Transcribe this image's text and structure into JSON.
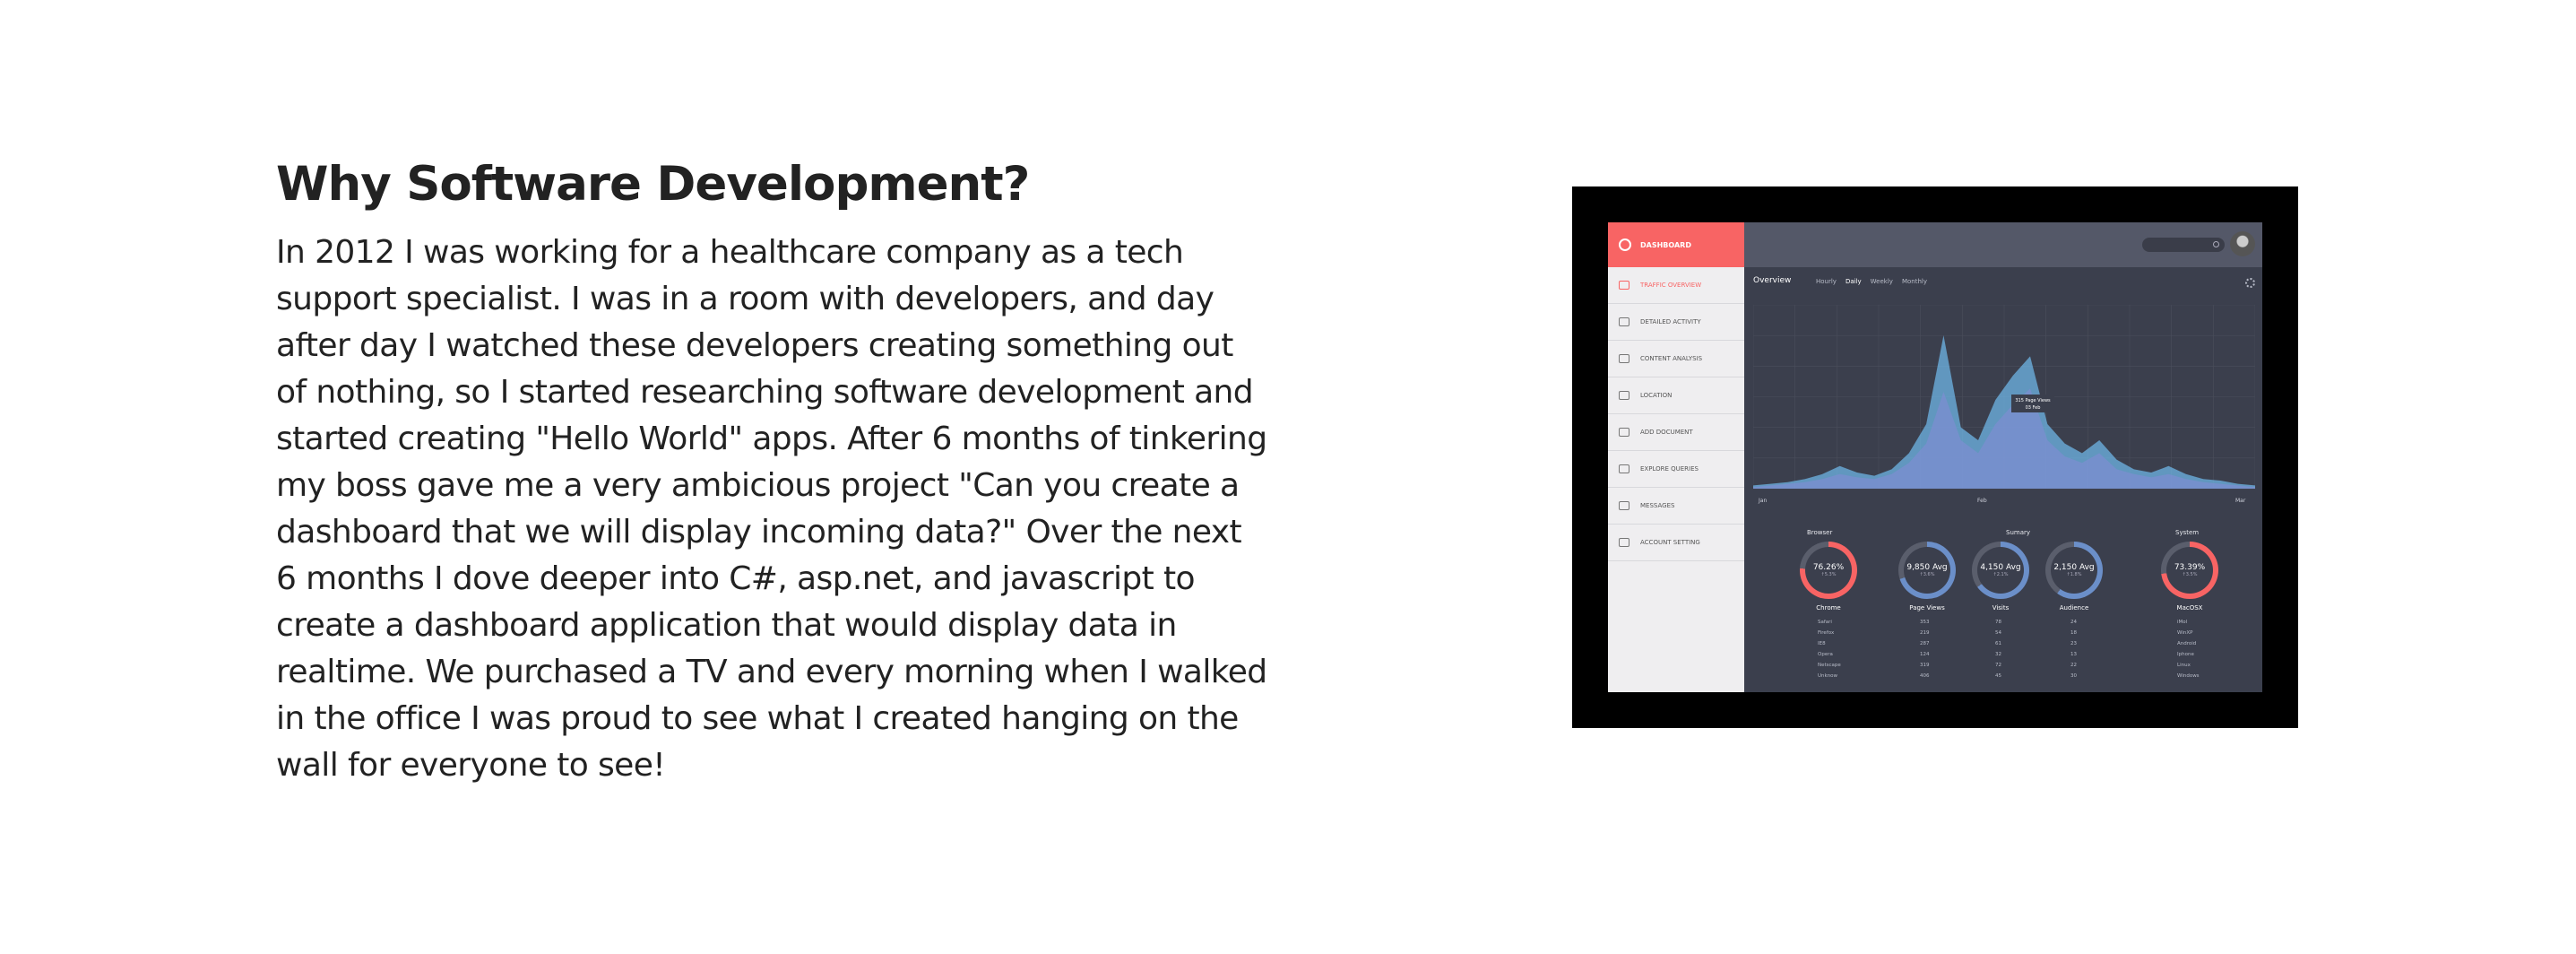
{
  "section": {
    "heading": "Why Software Development?",
    "paragraph": "In 2012 I was working for a healthcare company as a tech support specialist. I was in a room with developers, and day after day I watched these developers creating something out of nothing, so I started researching software development and started creating \"Hello World\" apps. After 6 months of tinkering my boss gave me a very ambicious project \"Can you create a dashboard that we will display incoming data?\" Over the next 6 months I dove deeper into C#, asp.net, and javascript to create a dashboard application that would display data in realtime. We purchased a TV and every morning when I walked in the office I was proud to see what I created hanging on the wall for everyone to see!"
  },
  "dashboard": {
    "sidebar": {
      "header": "DASHBOARD",
      "items": [
        {
          "label": "TRAFFIC OVERVIEW",
          "icon": "line-chart-icon"
        },
        {
          "label": "DETAILED ACTIVITY",
          "icon": "pie-icon"
        },
        {
          "label": "CONTENT ANALYSIS",
          "icon": "document-icon"
        },
        {
          "label": "LOCATION",
          "icon": "location-pin-icon"
        },
        {
          "label": "ADD DOCUMENT",
          "icon": "add-document-icon"
        },
        {
          "label": "EXPLORE QUERIES",
          "icon": "search-icon"
        },
        {
          "label": "MESSAGES",
          "icon": "chat-icon"
        },
        {
          "label": "ACCOUNT SETTING",
          "icon": "sliders-icon"
        }
      ]
    },
    "overview_title": "Overview",
    "tabs": [
      "Hourly",
      "Daily",
      "Weekly",
      "Monthly"
    ],
    "active_tab": "Daily",
    "tooltip": {
      "line1": "315 Page Views",
      "line2": "03 Feb"
    },
    "groups": {
      "browser": "Browser",
      "summary": "Sumary",
      "system": "System"
    },
    "rings": [
      {
        "value": "76.26%",
        "sub": "↑5.3%",
        "label": "Chrome",
        "color": "#f86464",
        "percent": 76
      },
      {
        "value": "9,850 Avg",
        "sub": "↑3.6%",
        "label": "Page Views",
        "color": "#6b8fc9",
        "percent": 70
      },
      {
        "value": "4,150 Avg",
        "sub": "↑2.1%",
        "label": "Visits",
        "color": "#6b8fc9",
        "percent": 65
      },
      {
        "value": "2,150 Avg",
        "sub": "↑1.8%",
        "label": "Audience",
        "color": "#6b8fc9",
        "percent": 60
      },
      {
        "value": "73.39%",
        "sub": "↑3.5%",
        "label": "MacOSX",
        "color": "#f86464",
        "percent": 73
      }
    ],
    "browser_rows": [
      "Safari",
      "Firefox",
      "IE8",
      "Opera",
      "Netscape",
      "Unknow"
    ],
    "pageview_rows": [
      "353",
      "219",
      "287",
      "124",
      "319",
      "406"
    ],
    "visit_rows": [
      "78",
      "54",
      "61",
      "32",
      "72",
      "45"
    ],
    "audience_rows": [
      "24",
      "18",
      "23",
      "13",
      "22",
      "30"
    ],
    "system_rows": [
      "iMol",
      "WinXP",
      "Android",
      "Iphone",
      "Linux",
      "Windows"
    ],
    "colors": {
      "accent": "#f86464",
      "background": "#3b3f4d",
      "sidebar": "#efeef0",
      "chart_fill": "#5aa6d8"
    }
  },
  "chart_data": {
    "type": "area",
    "x_labels": [
      "Jan",
      "Feb",
      "Mar"
    ],
    "series": [
      {
        "values": [
          2,
          3,
          4,
          6,
          9,
          14,
          10,
          8,
          12,
          22,
          40,
          95,
          38,
          30,
          55,
          70,
          82,
          40,
          28,
          22,
          30,
          18,
          12,
          10,
          14,
          9,
          6,
          5,
          3,
          2
        ]
      },
      {
        "values": [
          1,
          2,
          3,
          4,
          6,
          9,
          7,
          6,
          9,
          16,
          28,
          60,
          30,
          22,
          40,
          52,
          62,
          30,
          20,
          16,
          22,
          12,
          9,
          7,
          9,
          6,
          4,
          3,
          2,
          1
        ]
      }
    ]
  }
}
